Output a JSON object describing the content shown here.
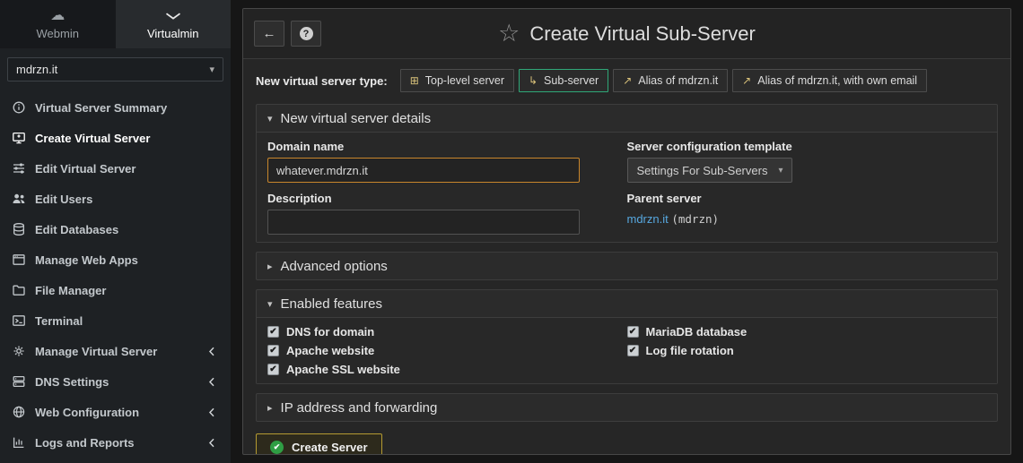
{
  "icons": {
    "cloud": "☁",
    "chevron": "▾",
    "caret_down": "▾",
    "caret_right": "▸",
    "select_caret": "▾",
    "back_arrow": "←",
    "help": "?",
    "star": "☆",
    "check": "✔",
    "top_level": "⊞",
    "sub_server": "↳",
    "alias": "↗"
  },
  "sidebar": {
    "tabs": [
      {
        "label": "Webmin"
      },
      {
        "label": "Virtualmin"
      }
    ],
    "server_select": {
      "value": "mdrzn.it"
    },
    "items": [
      {
        "label": "Virtual Server Summary"
      },
      {
        "label": "Create Virtual Server"
      },
      {
        "label": "Edit Virtual Server"
      },
      {
        "label": "Edit Users"
      },
      {
        "label": "Edit Databases"
      },
      {
        "label": "Manage Web Apps"
      },
      {
        "label": "File Manager"
      },
      {
        "label": "Terminal"
      },
      {
        "label": "Manage Virtual Server"
      },
      {
        "label": "DNS Settings"
      },
      {
        "label": "Web Configuration"
      },
      {
        "label": "Logs and Reports"
      }
    ]
  },
  "header": {
    "title": "Create Virtual Sub-Server"
  },
  "server_type": {
    "label": "New virtual server type:",
    "options": [
      {
        "label": "Top-level server"
      },
      {
        "label": "Sub-server"
      },
      {
        "label": "Alias of mdrzn.it"
      },
      {
        "label": "Alias of mdrzn.it, with own email"
      }
    ]
  },
  "details": {
    "title": "New virtual server details",
    "domain_label": "Domain name",
    "domain_value": "whatever.mdrzn.it",
    "description_label": "Description",
    "description_value": "",
    "template_label": "Server configuration template",
    "template_value": "Settings For Sub-Servers",
    "parent_label": "Parent server",
    "parent_link": "mdrzn.it",
    "parent_note": "(mdrzn)"
  },
  "advanced": {
    "title": "Advanced options"
  },
  "features": {
    "title": "Enabled features",
    "left": [
      {
        "label": "DNS for domain",
        "checked": true
      },
      {
        "label": "Apache website",
        "checked": true
      },
      {
        "label": "Apache SSL website",
        "checked": true
      }
    ],
    "right": [
      {
        "label": "MariaDB database",
        "checked": true
      },
      {
        "label": "Log file rotation",
        "checked": true
      }
    ]
  },
  "ip_forwarding": {
    "title": "IP address and forwarding"
  },
  "actions": {
    "create_label": "Create Server"
  },
  "colors": {
    "accent_green": "#2fa878",
    "accent_orange": "#c8862c",
    "accent_gold": "#b49a32",
    "link_blue": "#57a8e0"
  }
}
